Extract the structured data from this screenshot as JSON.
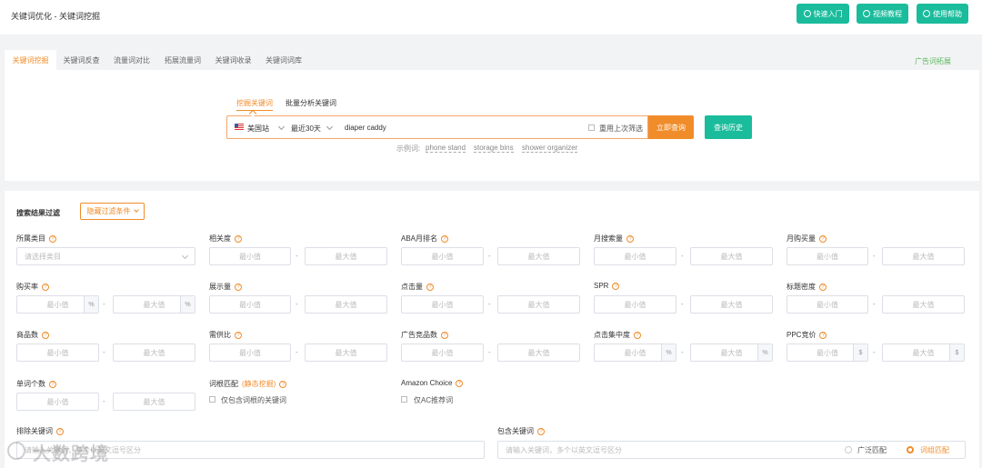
{
  "header": {
    "breadcrumb": "关键词优化 - 关键词挖掘",
    "quick_start": "快速入门",
    "video_tutorial": "视频教程",
    "help": "使用帮助"
  },
  "tabs": [
    "关键词挖掘",
    "关键词反查",
    "流量词对比",
    "拓展流量词",
    "关键词收录",
    "关键词词库"
  ],
  "ad_tab": "广告词拓展",
  "search": {
    "subtabs": [
      "挖掘关键词",
      "批量分析关键词"
    ],
    "site": "美国站",
    "period": "最近30天",
    "keyword": "diaper caddy",
    "reuse_label": "重用上次筛选",
    "query_button": "立即查询",
    "history_button": "查询历史",
    "examples_label": "示例词:",
    "examples": [
      "phone stand",
      "storage bins",
      "shower organizer"
    ]
  },
  "filter": {
    "title": "搜索结果过滤",
    "hide_button": "隐藏过滤条件",
    "min": "最小值",
    "max": "最大值",
    "category_label": "所属类目",
    "category_placeholder": "请选择类目",
    "labels": [
      "相关度",
      "ABA月排名",
      "月搜索量",
      "月购买量",
      "购买率",
      "展示量",
      "点击量",
      "SPR",
      "标题密度",
      "商品数",
      "需供比",
      "广告竞品数",
      "点击集中度",
      "PPC竞价",
      "单词个数"
    ],
    "root_label": "词根匹配",
    "root_link": "(静态挖掘)",
    "root_cb": "仅包含词根的关键词",
    "amazon_choice_label": "Amazon Choice",
    "ac_cb": "仅AC推荐词",
    "exclude_label": "排除关键词",
    "include_label": "包含关键词",
    "include_placeholder": "请输入关键词，多个以英文逗号区分",
    "exclude_placeholder": "请输入关键词，多个以英文逗号区分",
    "broad": "广泛匹配",
    "phrase": "词组匹配",
    "pct": "%",
    "dollar": "$"
  },
  "watermark": "大数跨境",
  "colors": {
    "accent": "#f08c2a",
    "green": "#1abc9c"
  }
}
